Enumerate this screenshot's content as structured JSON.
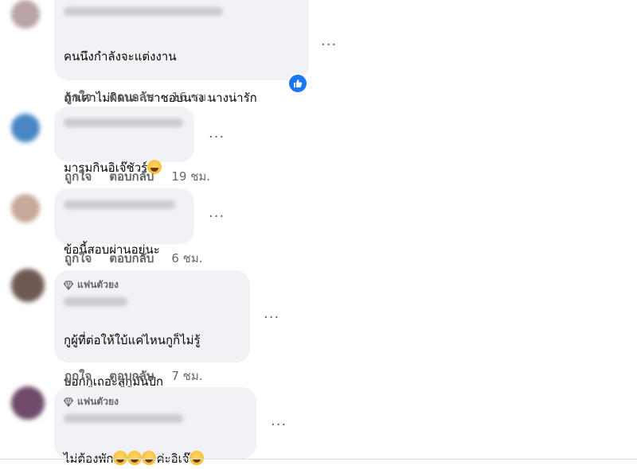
{
  "comments": [
    {
      "lines": [
        "คนนึงกำลังจะแต่งงาน",
        "ถ้าเดาไม่ผิดนะ เราชอบนาง นางน่ารัก"
      ],
      "like_label": "ถูกใจ",
      "reply_label": "ตอบกลับ",
      "time": "16 ชม.",
      "reaction_icon": "like-icon",
      "avatar_color": "#b9a4a8"
    },
    {
      "lines": [
        "มารุมกินอิเจ๊ชัวร์"
      ],
      "emoji": "winking-tongue-emoji",
      "like_label": "ถูกใจ",
      "reply_label": "ตอบกลับ",
      "time": "19 ชม.",
      "avatar_color": "#4a86c5"
    },
    {
      "lines": [
        "ข้อนี้สอบผ่านอยู่นะ"
      ],
      "like_label": "ถูกใจ",
      "reply_label": "ตอบกลับ",
      "time": "6 ชม.",
      "avatar_color": "#c8a898"
    },
    {
      "badge": "แฟนตัวยง",
      "lines": [
        "กูผู้ที่ต่อให้ใบ้แค่ไหนกูก็ไม่รู้",
        "บอกกูเถอะสูกูมันปีก"
      ],
      "like_label": "ถูกใจ",
      "reply_label": "ตอบกลับ",
      "time": "7 ชม.",
      "avatar_color": "#6e5a52"
    },
    {
      "badge": "แฟนตัวยง",
      "text_before": "ไม่ต้องพัก",
      "text_after": "ค่ะอิเจ๊",
      "emojis": [
        "grinning-emoji",
        "grinning-emoji",
        "grinning-emoji",
        "laughing-tears-emoji"
      ],
      "avatar_color": "#6f4a6a"
    }
  ],
  "more_label": "···"
}
